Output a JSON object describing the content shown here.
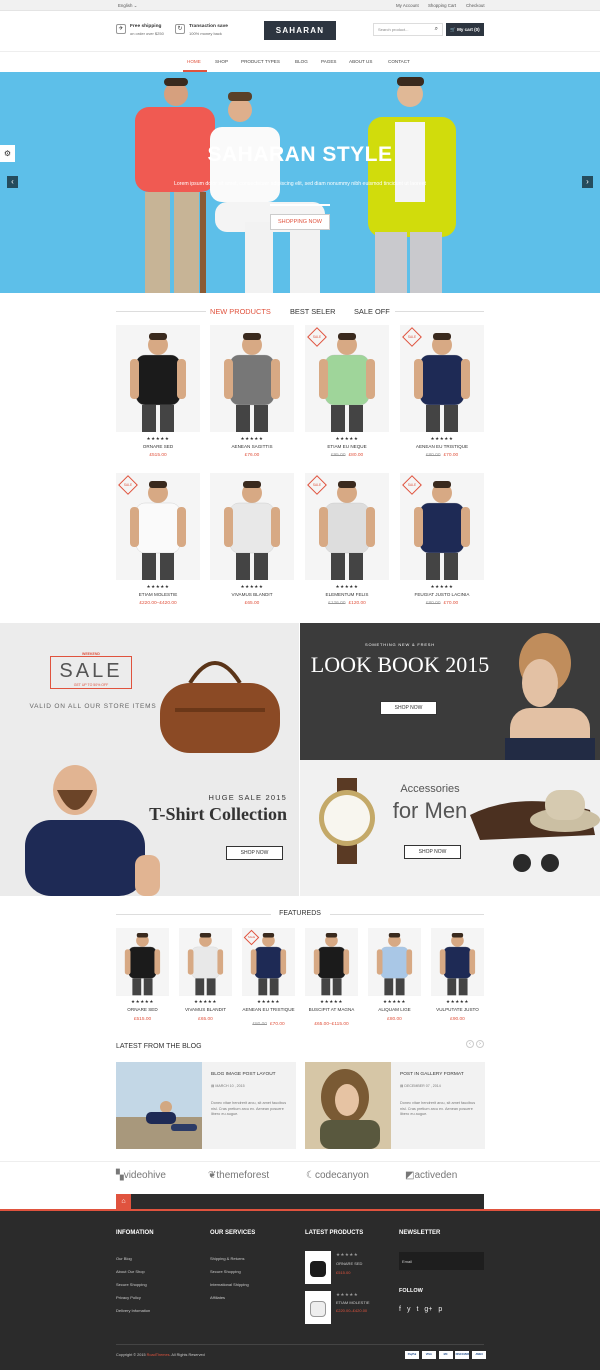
{
  "topbar": {
    "language": "English",
    "account": "My Account",
    "cart": "Shopping Cart",
    "checkout": "Checkout"
  },
  "header": {
    "ship_title": "Free shipping",
    "ship_sub": "on order over $250",
    "trans_title": "Transaction save",
    "trans_sub": "100% money back",
    "logo": "SAHARAN",
    "search_placeholder": "Search product...",
    "cart_label": "My cart (0)"
  },
  "nav": [
    "HOME",
    "SHOP",
    "PRODUCT TYPES",
    "BLOG",
    "PAGES",
    "ABOUT US",
    "CONTACT"
  ],
  "hero": {
    "title": "SAHARAN STYLE",
    "subtitle": "Lorem ipsum dolor sit amet, consectetuer adipiscing elit, sed diam nonummy nibh euismod tincidunt ut laoreet",
    "button": "SHOPPING NOW"
  },
  "tabs": [
    "NEW PRODUCTS",
    "BEST SELER",
    "SALE OFF"
  ],
  "products": [
    {
      "name": "ORNARE SED",
      "price": "£515.00",
      "old": "",
      "sale": false,
      "shirt": "#1b1b1b"
    },
    {
      "name": "AENEAN SAGITTIS",
      "price": "£76.00",
      "old": "",
      "sale": false,
      "shirt": "#777"
    },
    {
      "name": "ETIAM EU NEQUE",
      "price": "£80.00",
      "old": "£95.00",
      "sale": true,
      "shirt": "#9fd59a"
    },
    {
      "name": "AENEAN EU TRISTIQUE",
      "price": "£70.00",
      "old": "£80.00",
      "sale": true,
      "shirt": "#1e2a55"
    },
    {
      "name": "ETIAM MOLESTIE",
      "price": "£220.00–£420.00",
      "old": "",
      "sale": true,
      "shirt": "#fafafa"
    },
    {
      "name": "VIVAMUS BLANDIT",
      "price": "£65.00",
      "old": "",
      "sale": false,
      "shirt": "#e8e8e8"
    },
    {
      "name": "ELEMENTUM FELIS",
      "price": "£120.00",
      "old": "£126.00",
      "sale": true,
      "shirt": "#ddd"
    },
    {
      "name": "FEUGIAT JUSTO LACINIA",
      "price": "£70.00",
      "old": "£80.00",
      "sale": true,
      "shirt": "#1e2a55"
    }
  ],
  "banners": {
    "weekend": "WEEKEND",
    "sale": "SALE",
    "upto": "GET UP TO 50% OFF",
    "valid": "VALID ON ALL OUR STORE ITEMS",
    "something": "SOMETHING NEW & FRESH",
    "lookbook": "LOOK BOOK 2015",
    "shop_now": "SHOP NOW",
    "huge": "HUGE SALE 2015",
    "tshirt": "T-Shirt Collection",
    "acc1": "Accessories",
    "acc2": "for Men"
  },
  "featured": {
    "title": "FEATUREDS",
    "items": [
      {
        "name": "ORNARE SED",
        "price": "£515.00",
        "old": "",
        "shirt": "#1b1b1b",
        "sale": false
      },
      {
        "name": "VIVAMUS BLANDIT",
        "price": "£65.00",
        "old": "",
        "shirt": "#e8e8e8",
        "sale": false
      },
      {
        "name": "AENEAN EU TRISTIQUE",
        "price": "£70.00",
        "old": "£80.00",
        "shirt": "#1e2a55",
        "sale": true
      },
      {
        "name": "BUSCIPIT AT MAGNA",
        "price": "£65.00–£115.00",
        "old": "",
        "shirt": "#1b1b1b",
        "sale": false
      },
      {
        "name": "ALIQUAM LIGE",
        "price": "£80.00",
        "old": "",
        "shirt": "#a9c7e6",
        "sale": false
      },
      {
        "name": "VULPUTATE JUSTO",
        "price": "£90.00",
        "old": "",
        "shirt": "#1e2a55",
        "sale": false
      }
    ]
  },
  "blog": {
    "title": "LATEST FROM THE BLOG",
    "posts": [
      {
        "title": "BLOG IMAGE POST LAYOUT",
        "date": "MARCH 10 , 2015",
        "text": "Donec vitae hendrerit arcu, sit amet faucibus nisl. Cras pretium arcu ex. Aenean posuere libero eu augue."
      },
      {
        "title": "POST IN GALLERY FORMAT",
        "date": "DECEMBER 07 , 2014",
        "text": "Donec vitae hendrerit arcu, sit amet faucibus nisl. Cras pretium arcu ex. Aenean posuere libero eu augue."
      }
    ]
  },
  "brands": [
    "videohive",
    "themeforest",
    "codecanyon",
    "activeden"
  ],
  "footer": {
    "info_title": "INFOMATION",
    "info": [
      "Our Blog",
      "About Our Shop",
      "Secure Shopping",
      "Privacy Policy",
      "Delivery Infomation"
    ],
    "serv_title": "OUR SERVICES",
    "serv": [
      "Shipping & Returns",
      "Secure Shopping",
      "International Shipping",
      "Affiliates"
    ],
    "latest_title": "LATEST PRODUCTS",
    "latest": [
      {
        "name": "ORNARE SED",
        "price": "£515.00"
      },
      {
        "name": "ETIAM MOLESTIE",
        "price": "£220.00–£420.00"
      }
    ],
    "news_title": "NEWSLETTER",
    "email_placeholder": "Email",
    "follow": "FOLLOW",
    "social": [
      "f",
      "y",
      "t",
      "g+",
      "p"
    ],
    "copyright": "Copyright © 2015 ",
    "copyright_link": "RoadThemes",
    "copyright_end": ". All Rights Reserved",
    "payments": [
      "PayPal",
      "VISA",
      "MC",
      "DISCOVER",
      "AMEX"
    ]
  }
}
